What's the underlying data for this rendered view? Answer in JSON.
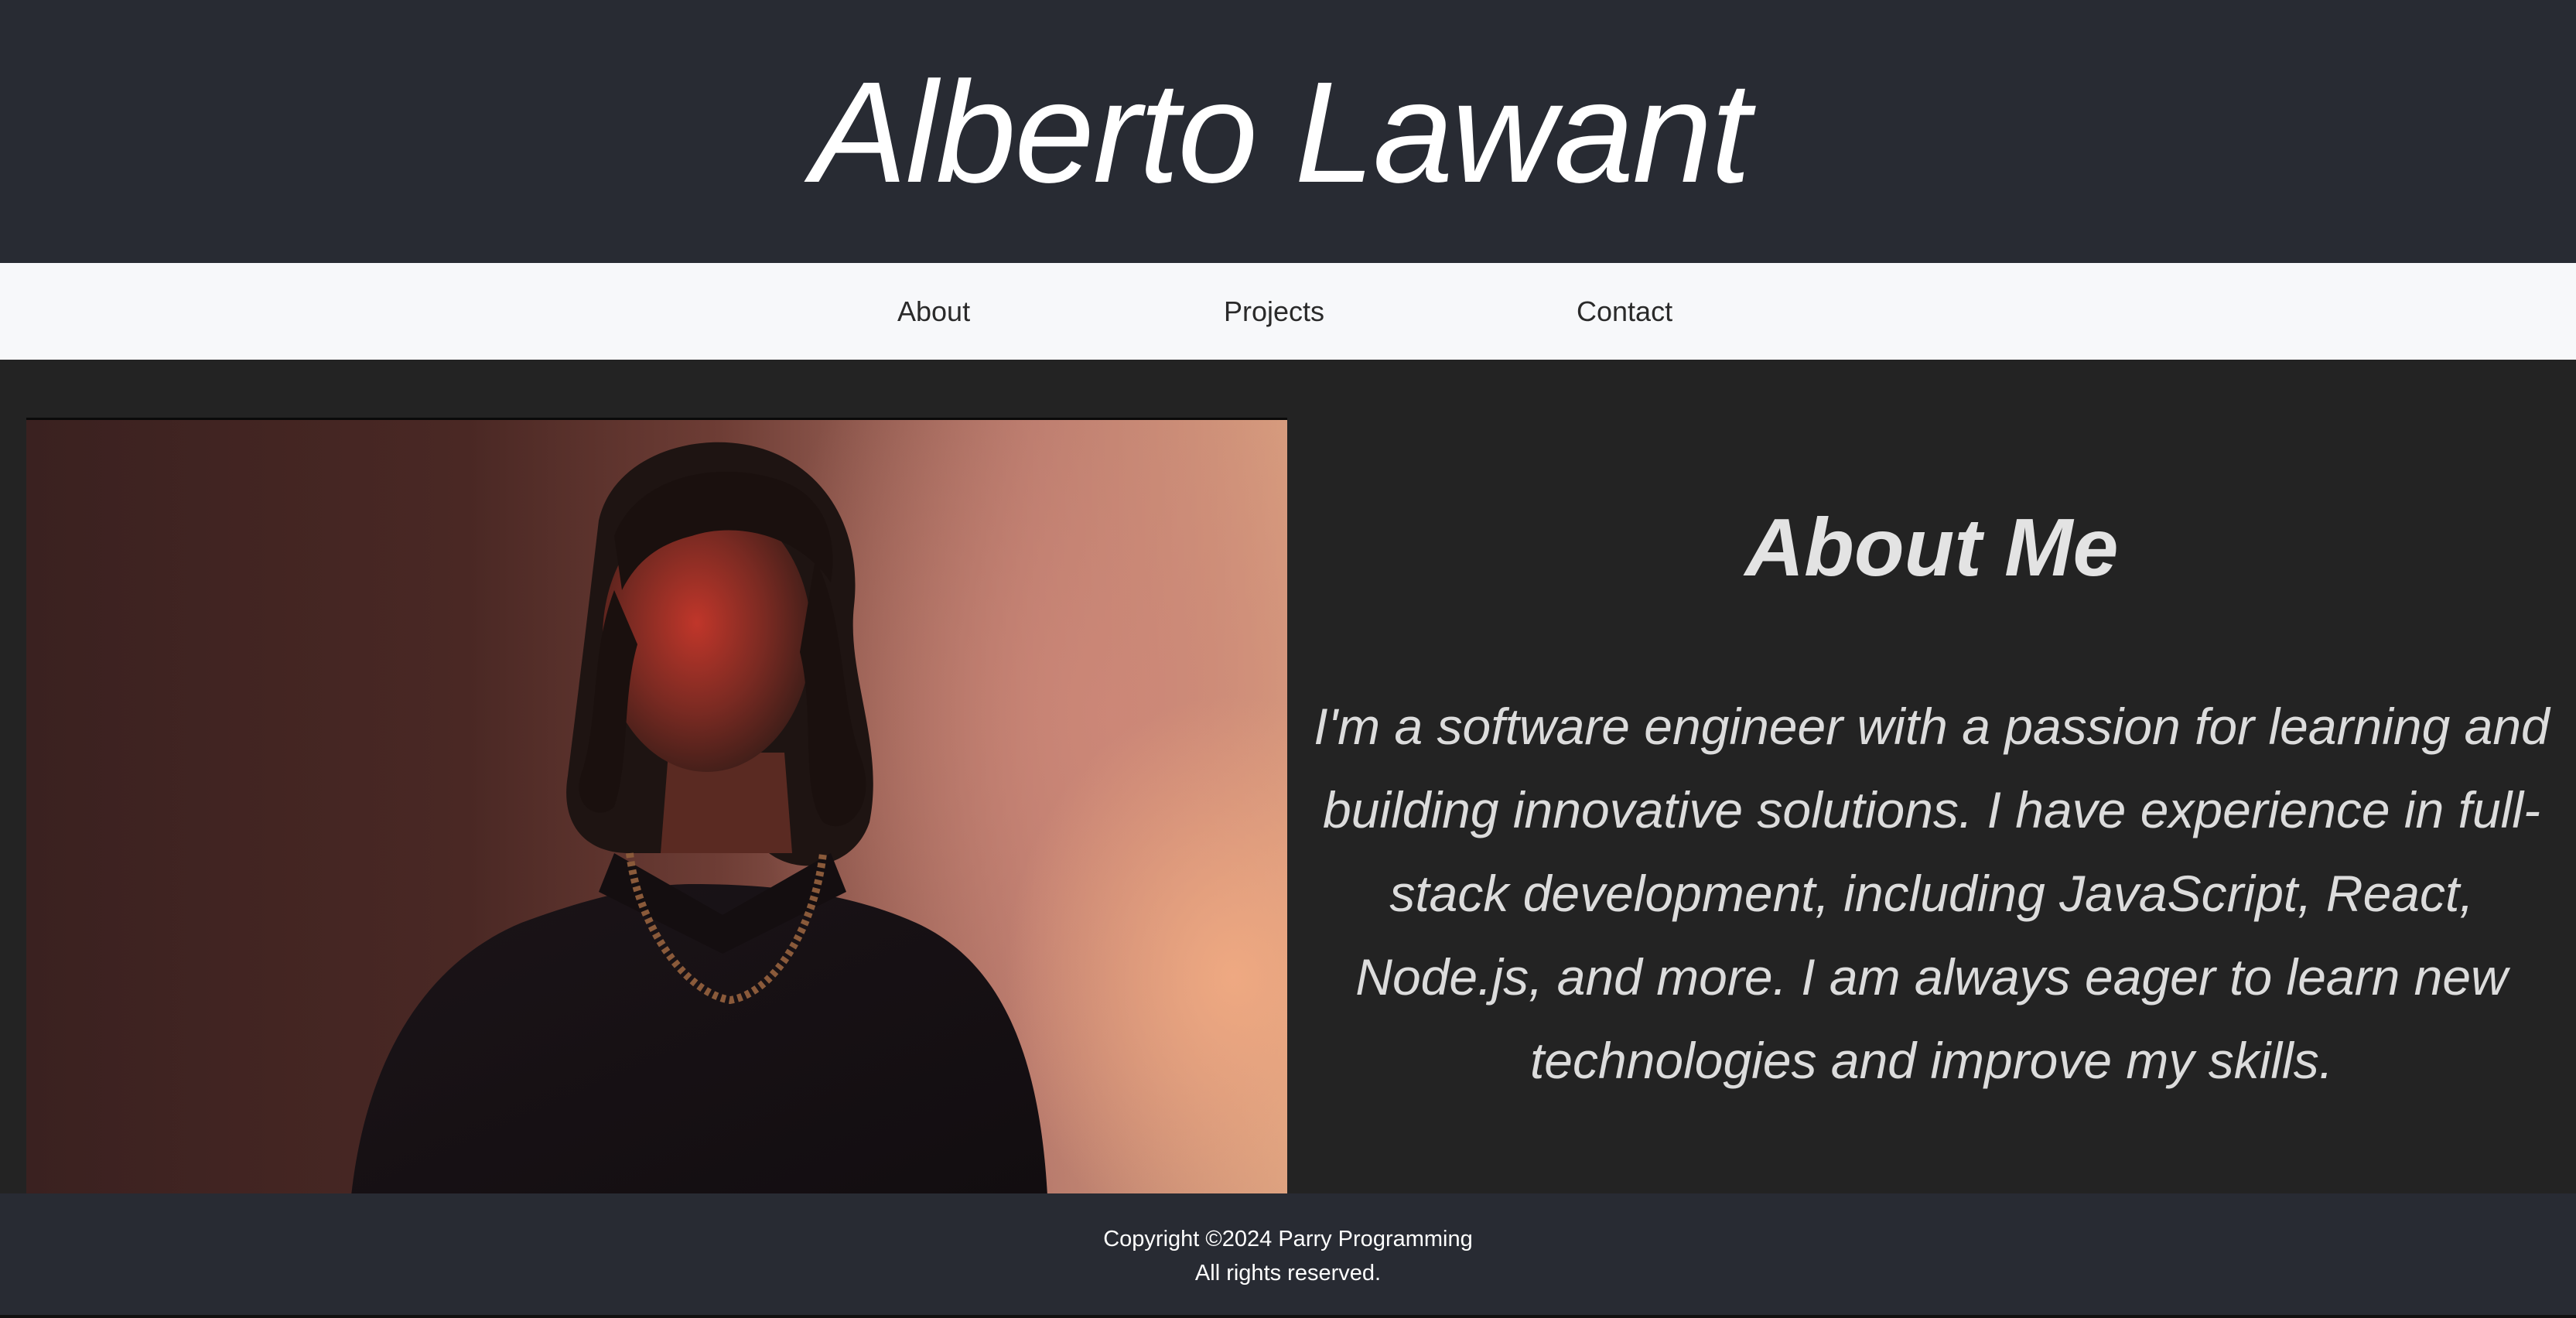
{
  "header": {
    "title": "Alberto Lawant"
  },
  "nav": {
    "items": [
      {
        "label": "About"
      },
      {
        "label": "Projects"
      },
      {
        "label": "Contact"
      }
    ]
  },
  "about": {
    "heading": "About Me",
    "body": "I'm a software engineer with a passion for learning and building innovative solutions. I have experience in full-stack development, including JavaScript, React, Node.js, and more. I am always eager to learn new technologies and improve my skills."
  },
  "footer": {
    "copyright": "Copyright ©2024 Parry Programming",
    "rights": "All rights reserved."
  },
  "colors": {
    "header_bg": "#282b33",
    "nav_bg": "#f7f8fa",
    "main_bg": "#232323",
    "text_light": "#e3e3e3"
  }
}
